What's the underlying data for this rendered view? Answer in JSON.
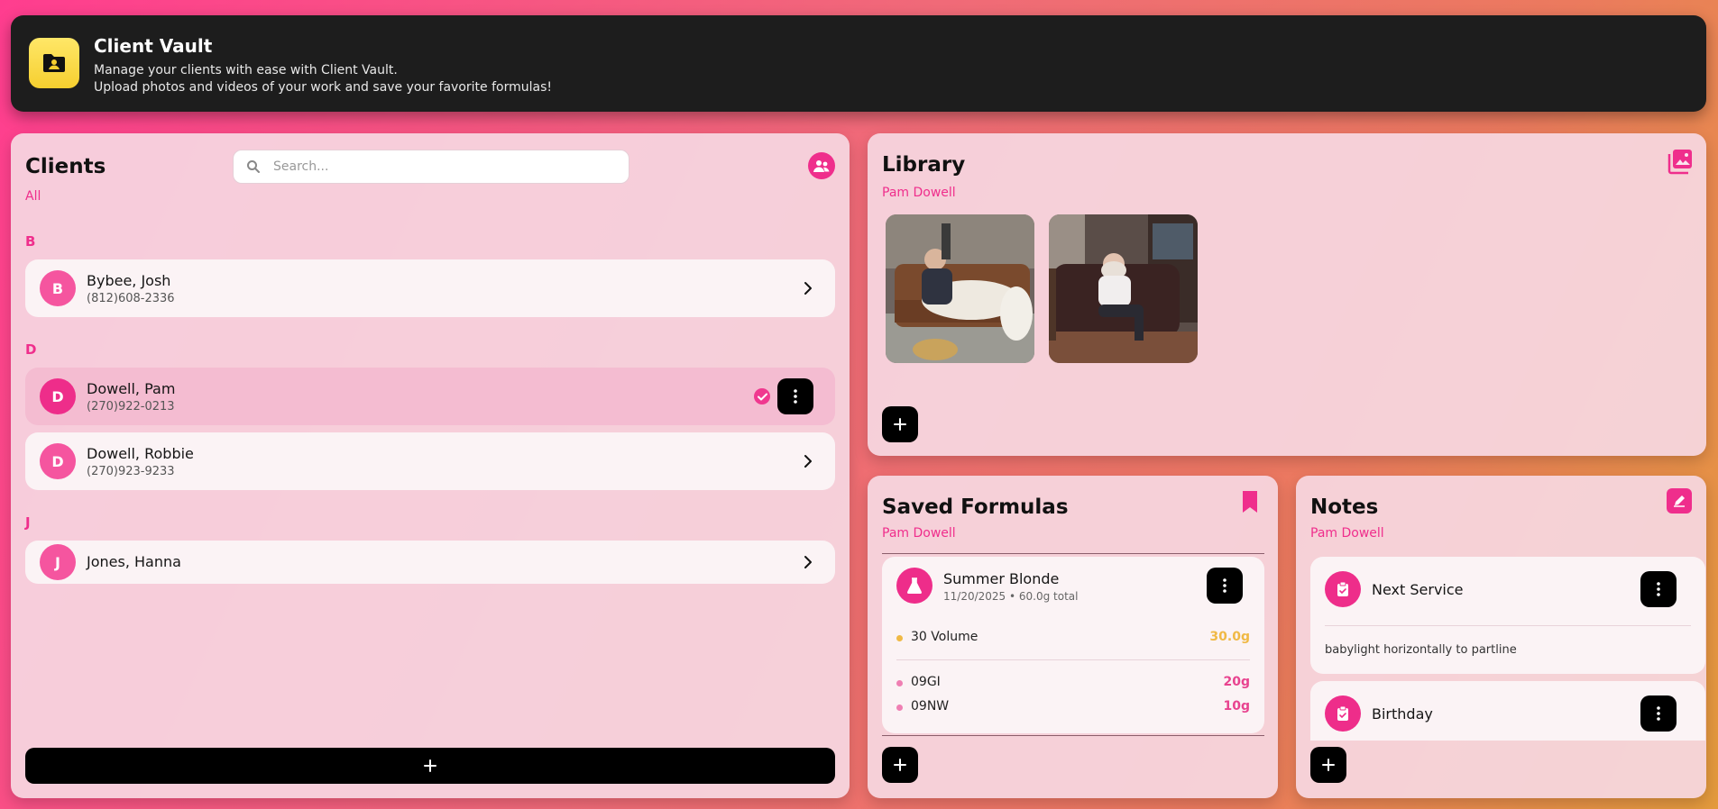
{
  "header": {
    "title": "Client Vault",
    "subtitle_line1": "Manage your clients with ease with Client Vault.",
    "subtitle_line2": "Upload photos and videos of your work and save your favorite formulas!"
  },
  "clients": {
    "title": "Clients",
    "filter": "All",
    "search_placeholder": "Search...",
    "groups": [
      {
        "letter": "B",
        "items": [
          {
            "initial": "B",
            "name": "Bybee, Josh",
            "phone": "(812)608-2336"
          }
        ]
      },
      {
        "letter": "D",
        "items": [
          {
            "initial": "D",
            "name": "Dowell, Pam",
            "phone": "(270)922-0213",
            "selected": true
          },
          {
            "initial": "D",
            "name": "Dowell, Robbie",
            "phone": "(270)923-9233"
          }
        ]
      },
      {
        "letter": "J",
        "items": [
          {
            "initial": "J",
            "name": "Jones, Hanna",
            "phone": ""
          }
        ]
      }
    ],
    "add_label": "+"
  },
  "library": {
    "title": "Library",
    "client": "Pam Dowell",
    "photos": [
      "photo-1",
      "photo-2"
    ],
    "add_label": "+"
  },
  "formulas": {
    "title": "Saved Formulas",
    "client": "Pam Dowell",
    "items": [
      {
        "name": "Summer Blonde",
        "meta": "11/20/2025 • 60.0g total",
        "developer": {
          "name": "30 Volume",
          "amount": "30.0g",
          "color": "#f0b945"
        },
        "colors": [
          {
            "name": "09GI",
            "amount": "20g",
            "color": "#ef7fb3"
          },
          {
            "name": "09NW",
            "amount": "10g",
            "color": "#ef7fb3"
          }
        ]
      }
    ],
    "add_label": "+"
  },
  "notes": {
    "title": "Notes",
    "client": "Pam Dowell",
    "items": [
      {
        "title": "Next Service",
        "body": "babylight horizontally to partline"
      },
      {
        "title": "Birthday",
        "body": ""
      }
    ],
    "add_label": "+"
  },
  "colors": {
    "accent": "#ef2e8c",
    "dark": "#000000",
    "developer_amount": "#f0b945",
    "color_amount": "#e8438f"
  }
}
